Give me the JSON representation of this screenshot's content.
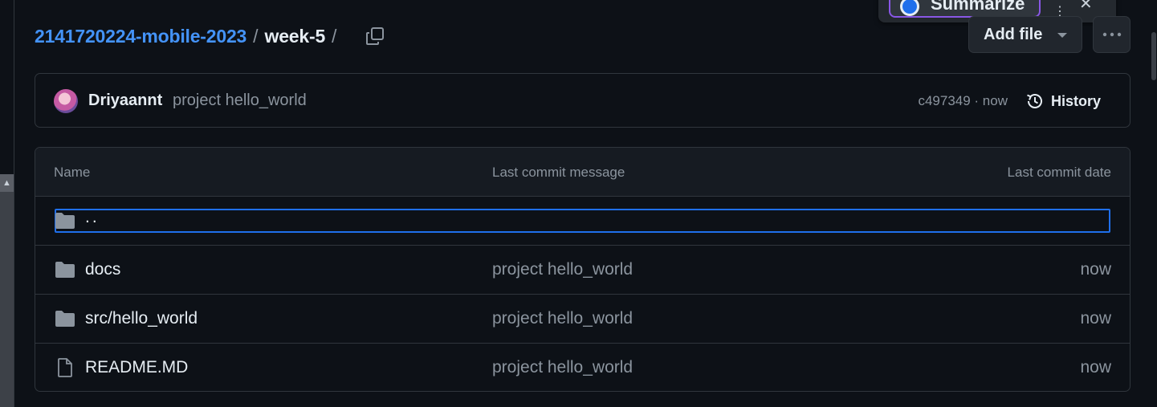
{
  "breadcrumb": {
    "repo": "2141720224-mobile-2023",
    "separator": "/",
    "current": "week-5",
    "trailing_separator": "/"
  },
  "popup": {
    "label": "Summarize"
  },
  "toolbar": {
    "add_file_label": "Add file"
  },
  "commit": {
    "author": "Driyaannt",
    "message": "project hello_world",
    "meta": "c497349 · now",
    "history_label": "History"
  },
  "files": {
    "columns": {
      "name": "Name",
      "message": "Last commit message",
      "date": "Last commit date"
    },
    "parent": "..",
    "rows": [
      {
        "name": "docs",
        "message": "project hello_world",
        "date": "now",
        "icon": "folder-icon"
      },
      {
        "name": "src/hello_world",
        "message": "project hello_world",
        "date": "now",
        "icon": "folder-icon"
      },
      {
        "name": "README.MD",
        "message": "project hello_world",
        "date": "now",
        "icon": "file-icon"
      }
    ]
  },
  "colors": {
    "background": "#0d1117",
    "accent_link": "#4493f8",
    "focus_ring": "#1f6feb",
    "border": "#30363d",
    "muted_text": "#8b949e"
  }
}
